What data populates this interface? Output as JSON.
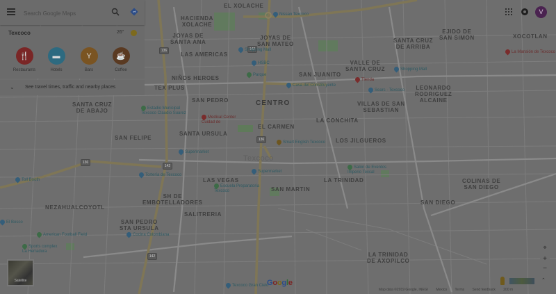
{
  "search": {
    "placeholder": "Search Google Maps"
  },
  "place_card": {
    "city": "Texcoco",
    "temperature": "26°",
    "categories": [
      {
        "label": "Restaurants",
        "icon": "fork-knife-icon",
        "color": "#7a2626",
        "glyph": "🍴"
      },
      {
        "label": "Hotels",
        "icon": "bed-icon",
        "color": "#2d6a80",
        "glyph": "▬"
      },
      {
        "label": "Bars",
        "icon": "cocktail-icon",
        "color": "#7a5422",
        "glyph": "Y"
      },
      {
        "label": "Coffee",
        "icon": "coffee-cup-icon",
        "color": "#5a3a22",
        "glyph": "☕"
      }
    ],
    "travel_text": "See travel times, traffic and nearby places"
  },
  "account": {
    "avatar_letter": "V"
  },
  "map": {
    "neighborhoods": [
      {
        "text": "EL XOLACHE",
        "big": false
      },
      {
        "text": "HACIENDA\nXOLACHE",
        "big": false
      },
      {
        "text": "JOYAS DE\nSANTA ANA",
        "big": false
      },
      {
        "text": "JOYAS DE\nSAN MATEO",
        "big": false
      },
      {
        "text": "LAS AMERICAS",
        "big": false
      },
      {
        "text": "EJIDO DE\nSAN SIMON",
        "big": false
      },
      {
        "text": "XOCOTLAN",
        "big": false
      },
      {
        "text": "SANTA CRUZ\nDE ARRIBA",
        "big": false
      },
      {
        "text": "VALLE DE\nSANTA CRUZ",
        "big": false
      },
      {
        "text": "NIÑOS HEROES",
        "big": false
      },
      {
        "text": "SAN JUANITO",
        "big": false
      },
      {
        "text": "TEX PLUS",
        "big": false
      },
      {
        "text": "LEONARDO\nRODRIGUEZ\nALCAINE",
        "big": false
      },
      {
        "text": "SANTA CRUZ\nDE ABAJO",
        "big": false
      },
      {
        "text": "SAN PEDRO",
        "big": false
      },
      {
        "text": "CENTRO",
        "big": true
      },
      {
        "text": "VILLAS DE SAN\nSEBASTIAN",
        "big": false
      },
      {
        "text": "EL CARMEN",
        "big": false
      },
      {
        "text": "LA CONCHITA",
        "big": false
      },
      {
        "text": "SANTA URSULA",
        "big": false
      },
      {
        "text": "SAN FELIPE",
        "big": false
      },
      {
        "text": "LOS JILGUEROS",
        "big": false
      },
      {
        "text": "LAS VEGAS",
        "big": false
      },
      {
        "text": "LA TRINIDAD",
        "big": false
      },
      {
        "text": "COLINAS DE\nSAN DIEGO",
        "big": false
      },
      {
        "text": "SAN MARTIN",
        "big": false
      },
      {
        "text": "SH DE\nEMBOTELLADORES",
        "big": false
      },
      {
        "text": "NEZAHUALCOYOTL",
        "big": false
      },
      {
        "text": "SAN DIEGO",
        "big": false
      },
      {
        "text": "SALITRERIA",
        "big": false
      },
      {
        "text": "SAN PEDRO\nSTA URSULA",
        "big": false
      },
      {
        "text": "LA TRINIDAD\nDE AXOPILCO",
        "big": false
      }
    ],
    "watermark": "Texcoco",
    "pois": [
      {
        "text": "Nissan Texcoco",
        "pin": "blue"
      },
      {
        "text": "Shopping Mall",
        "pin": "blue"
      },
      {
        "text": "HSBC",
        "pin": "blue"
      },
      {
        "text": "Parque",
        "pin": "green"
      },
      {
        "text": "Casa del Constituyente",
        "pin": "blue"
      },
      {
        "text": "Shopping Mall",
        "pin": "blue"
      },
      {
        "text": "Tienda",
        "pin": "red"
      },
      {
        "text": "Sears · Texcoco",
        "pin": "blue"
      },
      {
        "text": "La Mansión de Texcoco",
        "pin": "red"
      },
      {
        "text": "Estadio Municipal\nTexcoco Claudio Suarez",
        "pin": "green"
      },
      {
        "text": "Medical Center\nCuidad de",
        "pin": "red"
      },
      {
        "text": "Smart English Texcoco",
        "pin": "orange"
      },
      {
        "text": "Supermarket",
        "pin": "blue"
      },
      {
        "text": "Tortería de Texcoco",
        "pin": "blue"
      },
      {
        "text": "Supermarket",
        "pin": "blue"
      },
      {
        "text": "Salón de Eventos\nImperio Texcal",
        "pin": "green"
      },
      {
        "text": "Escuela Preparatoria\nTexcoco",
        "pin": "green"
      },
      {
        "text": "Toll Booth",
        "pin": "blue"
      },
      {
        "text": "American Football Field",
        "pin": "green"
      },
      {
        "text": "Sports complex\nLa Herradura",
        "pin": "green"
      },
      {
        "text": "El Bosco",
        "pin": "blue"
      },
      {
        "text": "Texcoco Gran Cielo",
        "pin": "blue"
      },
      {
        "text": "Cocina Colombiana",
        "pin": "blue"
      }
    ],
    "road_shields": [
      "136",
      "142",
      "136",
      "142",
      "142",
      "136"
    ]
  },
  "controls": {
    "layers_label": "Satellite",
    "zoom_in": "+",
    "zoom_out": "−",
    "expand_glyph": "⌃"
  },
  "google_logo": {
    "letters": [
      "G",
      "o",
      "o",
      "g",
      "l",
      "e"
    ],
    "colors": [
      "#2a4d8a",
      "#7a2626",
      "#7a6416",
      "#2a4d8a",
      "#2e6a37",
      "#7a2626"
    ]
  },
  "footer": {
    "items": [
      "Map data ©2019 Google, INEGI",
      "Mexico",
      "Terms",
      "Send feedback",
      "200 m"
    ]
  }
}
